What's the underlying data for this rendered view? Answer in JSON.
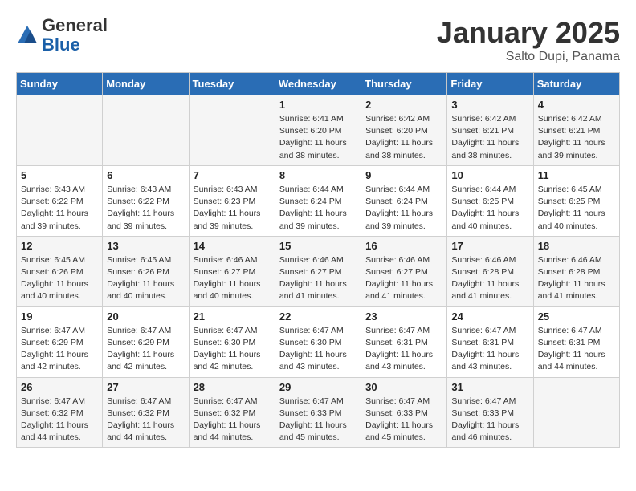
{
  "header": {
    "logo_general": "General",
    "logo_blue": "Blue",
    "month": "January 2025",
    "location": "Salto Dupi, Panama"
  },
  "weekdays": [
    "Sunday",
    "Monday",
    "Tuesday",
    "Wednesday",
    "Thursday",
    "Friday",
    "Saturday"
  ],
  "weeks": [
    [
      {
        "day": "",
        "info": ""
      },
      {
        "day": "",
        "info": ""
      },
      {
        "day": "",
        "info": ""
      },
      {
        "day": "1",
        "info": "Sunrise: 6:41 AM\nSunset: 6:20 PM\nDaylight: 11 hours\nand 38 minutes."
      },
      {
        "day": "2",
        "info": "Sunrise: 6:42 AM\nSunset: 6:20 PM\nDaylight: 11 hours\nand 38 minutes."
      },
      {
        "day": "3",
        "info": "Sunrise: 6:42 AM\nSunset: 6:21 PM\nDaylight: 11 hours\nand 38 minutes."
      },
      {
        "day": "4",
        "info": "Sunrise: 6:42 AM\nSunset: 6:21 PM\nDaylight: 11 hours\nand 39 minutes."
      }
    ],
    [
      {
        "day": "5",
        "info": "Sunrise: 6:43 AM\nSunset: 6:22 PM\nDaylight: 11 hours\nand 39 minutes."
      },
      {
        "day": "6",
        "info": "Sunrise: 6:43 AM\nSunset: 6:22 PM\nDaylight: 11 hours\nand 39 minutes."
      },
      {
        "day": "7",
        "info": "Sunrise: 6:43 AM\nSunset: 6:23 PM\nDaylight: 11 hours\nand 39 minutes."
      },
      {
        "day": "8",
        "info": "Sunrise: 6:44 AM\nSunset: 6:24 PM\nDaylight: 11 hours\nand 39 minutes."
      },
      {
        "day": "9",
        "info": "Sunrise: 6:44 AM\nSunset: 6:24 PM\nDaylight: 11 hours\nand 39 minutes."
      },
      {
        "day": "10",
        "info": "Sunrise: 6:44 AM\nSunset: 6:25 PM\nDaylight: 11 hours\nand 40 minutes."
      },
      {
        "day": "11",
        "info": "Sunrise: 6:45 AM\nSunset: 6:25 PM\nDaylight: 11 hours\nand 40 minutes."
      }
    ],
    [
      {
        "day": "12",
        "info": "Sunrise: 6:45 AM\nSunset: 6:26 PM\nDaylight: 11 hours\nand 40 minutes."
      },
      {
        "day": "13",
        "info": "Sunrise: 6:45 AM\nSunset: 6:26 PM\nDaylight: 11 hours\nand 40 minutes."
      },
      {
        "day": "14",
        "info": "Sunrise: 6:46 AM\nSunset: 6:27 PM\nDaylight: 11 hours\nand 40 minutes."
      },
      {
        "day": "15",
        "info": "Sunrise: 6:46 AM\nSunset: 6:27 PM\nDaylight: 11 hours\nand 41 minutes."
      },
      {
        "day": "16",
        "info": "Sunrise: 6:46 AM\nSunset: 6:27 PM\nDaylight: 11 hours\nand 41 minutes."
      },
      {
        "day": "17",
        "info": "Sunrise: 6:46 AM\nSunset: 6:28 PM\nDaylight: 11 hours\nand 41 minutes."
      },
      {
        "day": "18",
        "info": "Sunrise: 6:46 AM\nSunset: 6:28 PM\nDaylight: 11 hours\nand 41 minutes."
      }
    ],
    [
      {
        "day": "19",
        "info": "Sunrise: 6:47 AM\nSunset: 6:29 PM\nDaylight: 11 hours\nand 42 minutes."
      },
      {
        "day": "20",
        "info": "Sunrise: 6:47 AM\nSunset: 6:29 PM\nDaylight: 11 hours\nand 42 minutes."
      },
      {
        "day": "21",
        "info": "Sunrise: 6:47 AM\nSunset: 6:30 PM\nDaylight: 11 hours\nand 42 minutes."
      },
      {
        "day": "22",
        "info": "Sunrise: 6:47 AM\nSunset: 6:30 PM\nDaylight: 11 hours\nand 43 minutes."
      },
      {
        "day": "23",
        "info": "Sunrise: 6:47 AM\nSunset: 6:31 PM\nDaylight: 11 hours\nand 43 minutes."
      },
      {
        "day": "24",
        "info": "Sunrise: 6:47 AM\nSunset: 6:31 PM\nDaylight: 11 hours\nand 43 minutes."
      },
      {
        "day": "25",
        "info": "Sunrise: 6:47 AM\nSunset: 6:31 PM\nDaylight: 11 hours\nand 44 minutes."
      }
    ],
    [
      {
        "day": "26",
        "info": "Sunrise: 6:47 AM\nSunset: 6:32 PM\nDaylight: 11 hours\nand 44 minutes."
      },
      {
        "day": "27",
        "info": "Sunrise: 6:47 AM\nSunset: 6:32 PM\nDaylight: 11 hours\nand 44 minutes."
      },
      {
        "day": "28",
        "info": "Sunrise: 6:47 AM\nSunset: 6:32 PM\nDaylight: 11 hours\nand 44 minutes."
      },
      {
        "day": "29",
        "info": "Sunrise: 6:47 AM\nSunset: 6:33 PM\nDaylight: 11 hours\nand 45 minutes."
      },
      {
        "day": "30",
        "info": "Sunrise: 6:47 AM\nSunset: 6:33 PM\nDaylight: 11 hours\nand 45 minutes."
      },
      {
        "day": "31",
        "info": "Sunrise: 6:47 AM\nSunset: 6:33 PM\nDaylight: 11 hours\nand 46 minutes."
      },
      {
        "day": "",
        "info": ""
      }
    ]
  ]
}
